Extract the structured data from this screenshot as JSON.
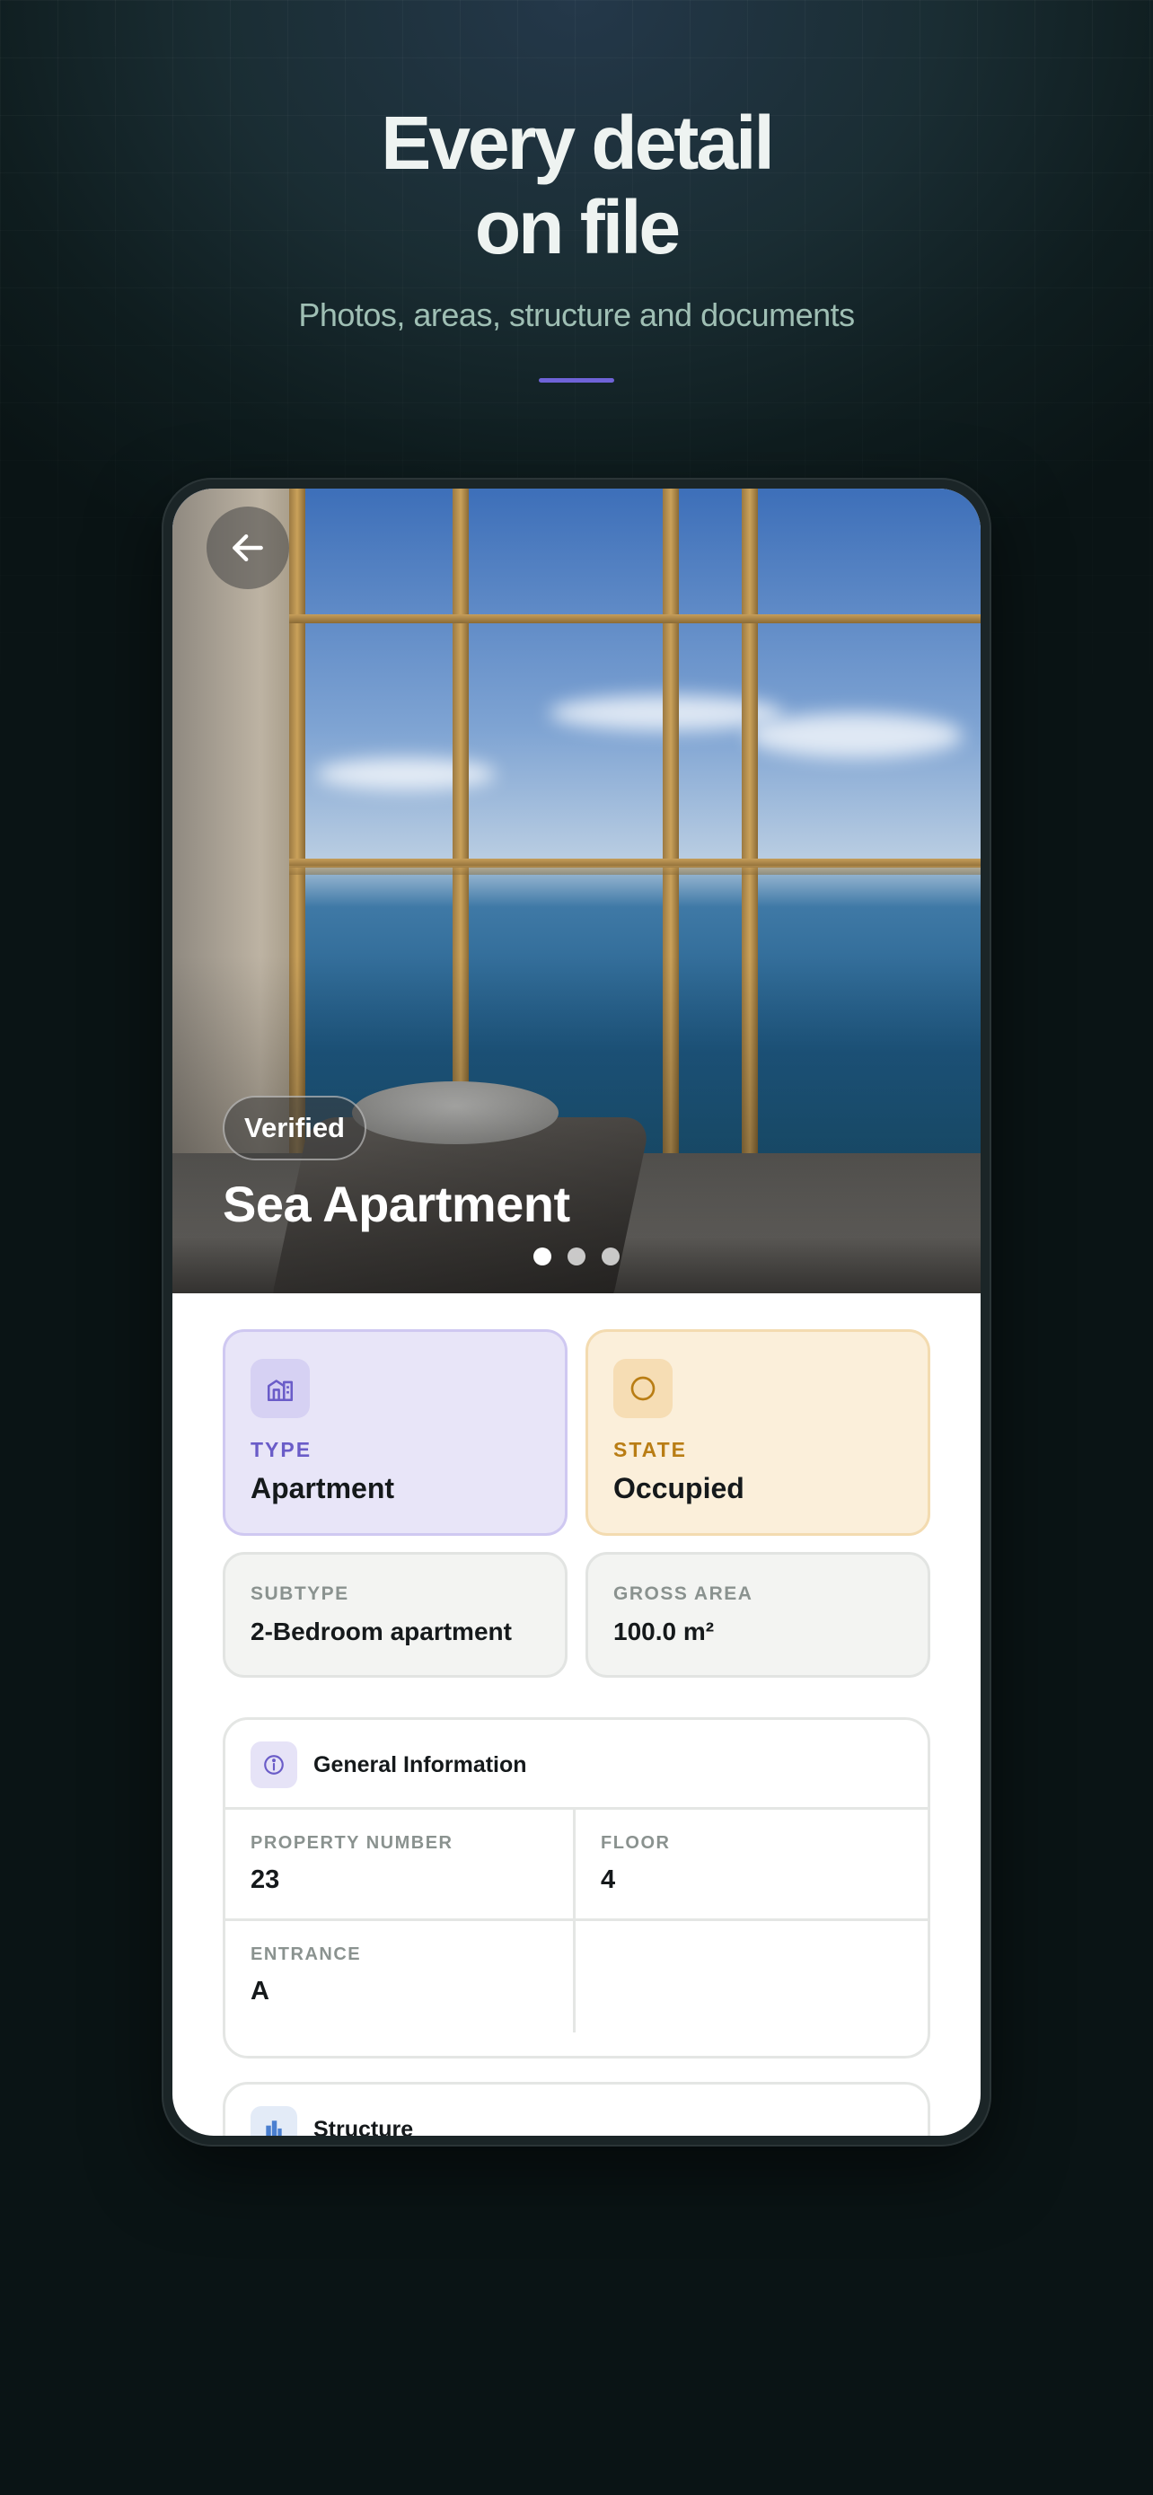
{
  "promo": {
    "headline_line1": "Every detail",
    "headline_line2": "on file",
    "subheadline": "Photos, areas, structure and documents",
    "accent_color": "#6f63d8"
  },
  "hero": {
    "back_icon": "arrow-left-icon",
    "badge": "Verified",
    "title": "Sea Apartment",
    "carousel": {
      "count": 3,
      "active_index": 0
    }
  },
  "summary": {
    "type": {
      "icon": "building-icon",
      "label": "TYPE",
      "value": "Apartment",
      "color": "#6a5cc8"
    },
    "state": {
      "icon": "circle-icon",
      "label": "STATE",
      "value": "Occupied",
      "color": "#b97d14"
    },
    "subtype": {
      "label": "SUBTYPE",
      "value": "2-Bedroom apartment"
    },
    "gross_area": {
      "label": "GROSS AREA",
      "value": "100.0 m²"
    }
  },
  "general_info": {
    "icon": "info-icon",
    "title": "General Information",
    "fields": [
      {
        "label": "PROPERTY NUMBER",
        "value": "23"
      },
      {
        "label": "FLOOR",
        "value": "4"
      },
      {
        "label": "ENTRANCE",
        "value": "A"
      }
    ]
  },
  "structure": {
    "icon": "building-blocks-icon",
    "title": "Structure"
  }
}
